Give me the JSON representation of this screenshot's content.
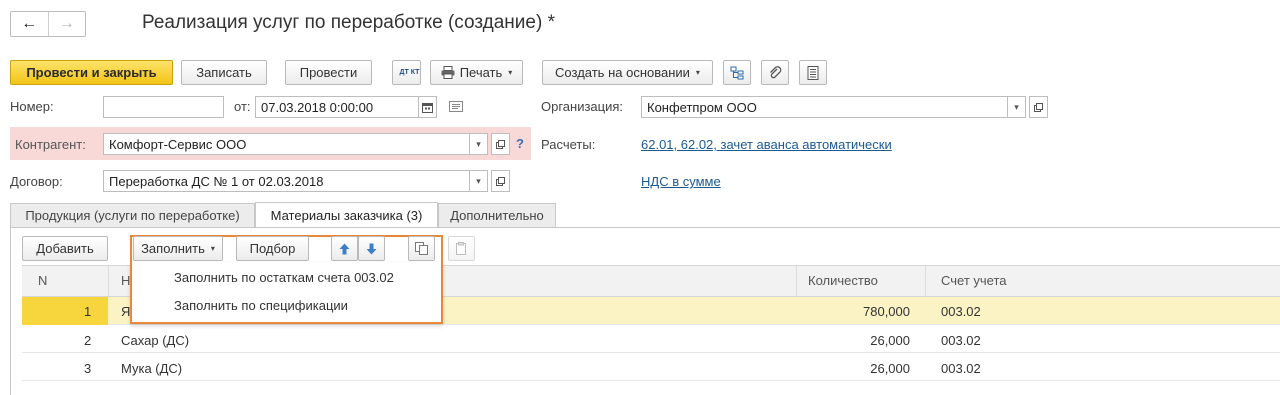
{
  "window": {
    "title": "Реализация услуг по переработке (создание) *",
    "nav_back": "←",
    "nav_forward": "→"
  },
  "toolbar": {
    "post_close": "Провести и закрыть",
    "save": "Записать",
    "post": "Провести",
    "dtkt_icon_text": "ДТ КТ",
    "print": "Печать",
    "create_based": "Создать на основании"
  },
  "form": {
    "number_label": "Номер:",
    "number_value": "",
    "date_from_label": "от:",
    "date_value": "07.03.2018  0:00:00",
    "org_label": "Организация:",
    "org_value": "Конфетпром ООО",
    "contragent_label": "Контрагент:",
    "contragent_value": "Комфорт-Сервис ООО",
    "help_mark": "?",
    "settlements_label": "Расчеты:",
    "settlements_link": "62.01, 62.02, зачет аванса автоматически",
    "contract_label": "Договор:",
    "contract_value": "Переработка ДС № 1 от 02.03.2018",
    "vat_link": "НДС в сумме"
  },
  "tabs": [
    {
      "label": "Продукция (услуги по переработке)"
    },
    {
      "label": "Материалы заказчика (3)"
    },
    {
      "label": "Дополнительно"
    }
  ],
  "table_toolbar": {
    "add": "Добавить",
    "fill": "Заполнить",
    "selection": "Подбор"
  },
  "fill_menu": {
    "items": [
      "Заполнить по остаткам счета 003.02",
      "Заполнить по спецификации"
    ]
  },
  "table": {
    "headers": {
      "n": "N",
      "name": "Н",
      "qty": "Количество",
      "account": "Счет учета"
    },
    "rows": [
      {
        "n": "1",
        "name": "Я",
        "qty": "780,000",
        "account": "003.02"
      },
      {
        "n": "2",
        "name": "Сахар (ДС)",
        "qty": "26,000",
        "account": "003.02"
      },
      {
        "n": "3",
        "name": "Мука (ДС)",
        "qty": "26,000",
        "account": "003.02"
      }
    ]
  },
  "colors": {
    "primary_button": "#f2c417",
    "highlight_frame": "#e8883a",
    "link": "#1c5a94",
    "required_bg": "#f8d9d8",
    "selected_row": "#fbf3c3"
  }
}
